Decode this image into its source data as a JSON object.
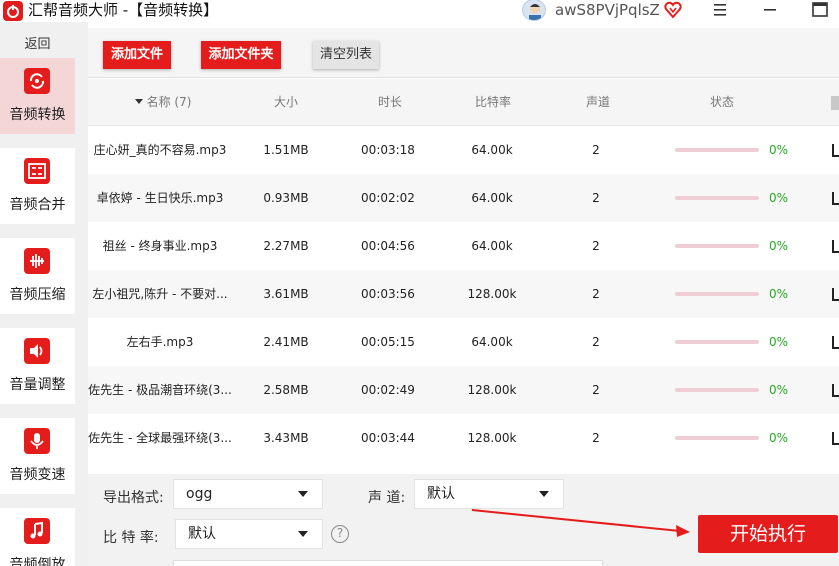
{
  "window": {
    "title": "汇帮音频大师 -【音频转换】",
    "username": "awS8PVjPqlsZ"
  },
  "sidebar": {
    "back_label": "返回",
    "items": [
      {
        "label": "音频转换",
        "icon": "audio-convert-icon",
        "active": true
      },
      {
        "label": "音频合并",
        "icon": "audio-merge-icon",
        "active": false
      },
      {
        "label": "音频压缩",
        "icon": "audio-compress-icon",
        "active": false
      },
      {
        "label": "音量调整",
        "icon": "volume-icon",
        "active": false
      },
      {
        "label": "音频变速",
        "icon": "microphone-icon",
        "active": false
      },
      {
        "label": "音频倒放",
        "icon": "music-note-icon",
        "active": false
      }
    ]
  },
  "toolbar": {
    "add_file": "添加文件",
    "add_folder": "添加文件夹",
    "clear_list": "清空列表"
  },
  "table": {
    "headers": {
      "name": "名称 (7)",
      "size": "大小",
      "duration": "时长",
      "bitrate": "比特率",
      "channels": "声道",
      "status": "状态"
    },
    "rows": [
      {
        "name": "庄心妍_真的不容易.mp3",
        "size": "1.51MB",
        "duration": "00:03:18",
        "bitrate": "64.00k",
        "channels": "2",
        "progress": "0%"
      },
      {
        "name": "卓依婷 - 生日快乐.mp3",
        "size": "0.93MB",
        "duration": "00:02:02",
        "bitrate": "64.00k",
        "channels": "2",
        "progress": "0%"
      },
      {
        "name": "祖丝 - 终身事业.mp3",
        "size": "2.27MB",
        "duration": "00:04:56",
        "bitrate": "64.00k",
        "channels": "2",
        "progress": "0%"
      },
      {
        "name": "左小祖咒,陈升 - 不要对...",
        "size": "3.61MB",
        "duration": "00:03:56",
        "bitrate": "128.00k",
        "channels": "2",
        "progress": "0%"
      },
      {
        "name": "左右手.mp3",
        "size": "2.41MB",
        "duration": "00:05:15",
        "bitrate": "64.00k",
        "channels": "2",
        "progress": "0%"
      },
      {
        "name": "佐先生 - 极品潮音环绕(3...",
        "size": "2.58MB",
        "duration": "00:02:49",
        "bitrate": "128.00k",
        "channels": "2",
        "progress": "0%"
      },
      {
        "name": "佐先生 - 全球最强环绕(3...",
        "size": "3.43MB",
        "duration": "00:03:44",
        "bitrate": "128.00k",
        "channels": "2",
        "progress": "0%"
      }
    ]
  },
  "settings": {
    "format_label": "导出格式:",
    "format_value": "ogg",
    "channel_label": "声 道:",
    "channel_value": "默认",
    "bitrate_label": "比 特 率:",
    "bitrate_value": "默认",
    "help_symbol": "?",
    "start_label": "开始执行"
  },
  "colors": {
    "accent": "#e51c1c",
    "progress_text": "#26a626",
    "active_sidebar": "#f4d6d6"
  }
}
